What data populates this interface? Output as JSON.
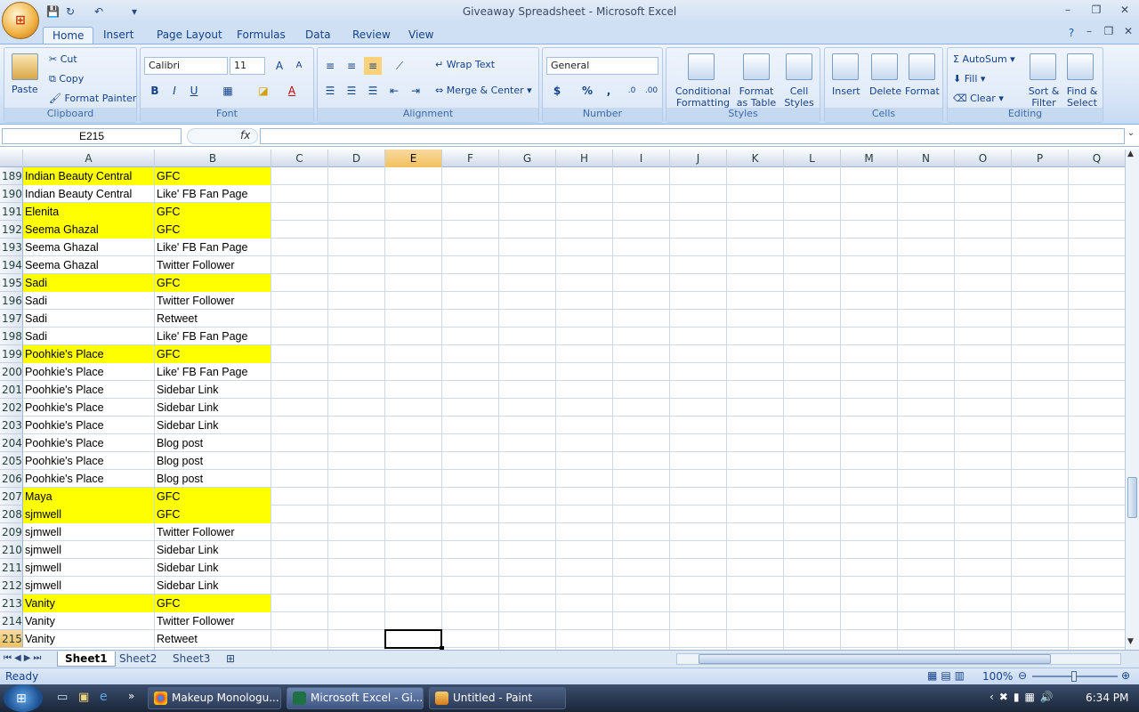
{
  "window": {
    "title": "Giveaway Spreadsheet - Microsoft Excel"
  },
  "ribbon_tabs": [
    "Home",
    "Insert",
    "Page Layout",
    "Formulas",
    "Data",
    "Review",
    "View"
  ],
  "clipboard": {
    "paste": "Paste",
    "cut": "Cut",
    "copy": "Copy",
    "format_painter": "Format Painter",
    "label": "Clipboard"
  },
  "font": {
    "name": "Calibri",
    "size": "11",
    "label": "Font",
    "bold": "B",
    "italic": "I",
    "underline": "U"
  },
  "alignment": {
    "wrap": "Wrap Text",
    "merge": "Merge & Center",
    "label": "Alignment"
  },
  "number": {
    "format": "General",
    "label": "Number",
    "currency": "$",
    "percent": "%",
    "comma": ","
  },
  "styles": {
    "cond1": "Conditional",
    "cond2": "Formatting",
    "fmt1": "Format",
    "fmt2": "as Table",
    "cell1": "Cell",
    "cell2": "Styles",
    "label": "Styles"
  },
  "cells": {
    "insert": "Insert",
    "delete": "Delete",
    "format": "Format",
    "label": "Cells"
  },
  "editing": {
    "autosum": "AutoSum",
    "fill": "Fill",
    "clear": "Clear",
    "sort1": "Sort &",
    "sort2": "Filter",
    "find1": "Find &",
    "find2": "Select",
    "label": "Editing"
  },
  "formula_bar": {
    "name_box": "E215",
    "fx": "fx",
    "value": ""
  },
  "columns": [
    "A",
    "B",
    "C",
    "D",
    "E",
    "F",
    "G",
    "H",
    "I",
    "J",
    "K",
    "L",
    "M",
    "N",
    "O",
    "P",
    "Q"
  ],
  "selected_column": "E",
  "rows": [
    {
      "n": "189",
      "a": "Indian Beauty Central",
      "b": "GFC",
      "hl": true
    },
    {
      "n": "190",
      "a": "Indian Beauty Central",
      "b": "Like' FB Fan Page",
      "hl": false
    },
    {
      "n": "191",
      "a": "Elenita",
      "b": "GFC",
      "hl": true
    },
    {
      "n": "192",
      "a": "Seema Ghazal",
      "b": "GFC",
      "hl": true
    },
    {
      "n": "193",
      "a": "Seema Ghazal",
      "b": "Like' FB Fan Page",
      "hl": false
    },
    {
      "n": "194",
      "a": "Seema Ghazal",
      "b": "Twitter Follower",
      "hl": false
    },
    {
      "n": "195",
      "a": "Sadi",
      "b": "GFC",
      "hl": true
    },
    {
      "n": "196",
      "a": "Sadi",
      "b": "Twitter Follower",
      "hl": false
    },
    {
      "n": "197",
      "a": "Sadi",
      "b": "Retweet",
      "hl": false
    },
    {
      "n": "198",
      "a": "Sadi",
      "b": "Like' FB Fan Page",
      "hl": false
    },
    {
      "n": "199",
      "a": "Poohkie's Place",
      "b": "GFC",
      "hl": true
    },
    {
      "n": "200",
      "a": "Poohkie's Place",
      "b": "Like' FB Fan Page",
      "hl": false
    },
    {
      "n": "201",
      "a": "Poohkie's Place",
      "b": "Sidebar Link",
      "hl": false
    },
    {
      "n": "202",
      "a": "Poohkie's Place",
      "b": "Sidebar Link",
      "hl": false
    },
    {
      "n": "203",
      "a": "Poohkie's Place",
      "b": "Sidebar Link",
      "hl": false
    },
    {
      "n": "204",
      "a": "Poohkie's Place",
      "b": "Blog post",
      "hl": false
    },
    {
      "n": "205",
      "a": "Poohkie's Place",
      "b": "Blog post",
      "hl": false
    },
    {
      "n": "206",
      "a": "Poohkie's Place",
      "b": "Blog post",
      "hl": false
    },
    {
      "n": "207",
      "a": "Maya",
      "b": "GFC",
      "hl": true
    },
    {
      "n": "208",
      "a": "sjmwell",
      "b": "GFC",
      "hl": true
    },
    {
      "n": "209",
      "a": "sjmwell",
      "b": "Twitter Follower",
      "hl": false
    },
    {
      "n": "210",
      "a": "sjmwell",
      "b": "Sidebar Link",
      "hl": false
    },
    {
      "n": "211",
      "a": "sjmwell",
      "b": "Sidebar Link",
      "hl": false
    },
    {
      "n": "212",
      "a": "sjmwell",
      "b": "Sidebar Link",
      "hl": false
    },
    {
      "n": "213",
      "a": "Vanity",
      "b": "GFC",
      "hl": true
    },
    {
      "n": "214",
      "a": "Vanity",
      "b": "Twitter Follower",
      "hl": false
    },
    {
      "n": "215",
      "a": "Vanity",
      "b": "Retweet",
      "hl": false
    }
  ],
  "highlight_color": "#ffff00",
  "sheet_tabs": [
    "Sheet1",
    "Sheet2",
    "Sheet3"
  ],
  "active_sheet": "Sheet1",
  "status": {
    "ready": "Ready",
    "zoom": "100%"
  },
  "taskbar": {
    "tasks": [
      {
        "label": "Makeup Monologu...",
        "icon": "chrome-icon"
      },
      {
        "label": "Microsoft Excel - Gi...",
        "icon": "excel-icon"
      },
      {
        "label": "Untitled - Paint",
        "icon": "paint-icon"
      }
    ],
    "clock": "6:34 PM"
  }
}
